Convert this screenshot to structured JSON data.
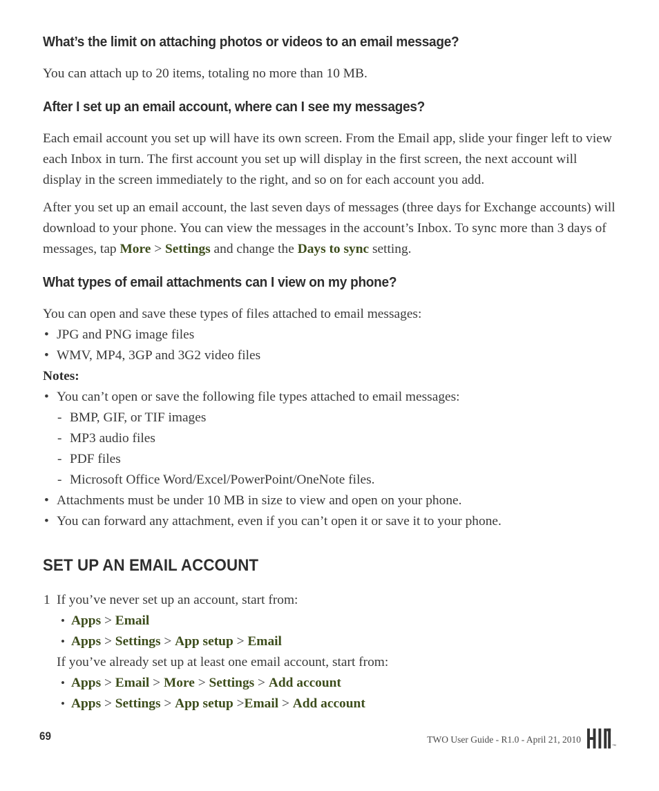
{
  "document": {
    "page_number": "69",
    "footer_text": "TWO User Guide - R1.0 - April 21, 2010",
    "logo_name": "KIN",
    "logo_trademark": "™",
    "accent_color": "#3d4d1c",
    "text_color": "#3a3a3a",
    "heading_color": "#2e2e2e"
  },
  "faq": {
    "q1": {
      "heading": "What’s the limit on attaching photos or videos to an email message?",
      "answer": "You can attach up to 20 items, totaling no more than 10 MB."
    },
    "q2": {
      "heading": "After I set up an email account, where can I see my messages?",
      "para1": "Each email account you set up will have its own screen. From the Email app, slide your finger left to view each Inbox in turn. The first account you set up will display in the first screen, the next account will display in the screen immediately to the right, and so on for each account you add.",
      "para2_a": "After you set up an email account, the last seven days of messages (three days for Exchange accounts) will download to your phone. You can view the messages in the account’s Inbox. To sync more than 3 days of messages, tap ",
      "para2_term1": "More",
      "para2_sep1": " > ",
      "para2_term2": "Settings",
      "para2_b": " and change the ",
      "para2_term3": "Days to sync",
      "para2_c": " setting."
    },
    "q3": {
      "heading": "What types of email attachments can I view on my phone?",
      "intro": "You can open and save these types of files attached to email messages:",
      "file_types": [
        "JPG and PNG image files",
        "WMV, MP4, 3GP and 3G2 video files"
      ],
      "notes_label": "Notes:",
      "note1": "You can’t open or save the following file types attached to email messages:",
      "unsupported": [
        "BMP, GIF, or TIF images",
        "MP3 audio files",
        "PDF files",
        "Microsoft Office Word/Excel/PowerPoint/OneNote files."
      ],
      "note2": "Attachments must be under 10 MB in size to view and open on your phone.",
      "note3": "You can forward any attachment, even if you can’t open it or save it to your phone."
    }
  },
  "setup_section": {
    "heading": "SET UP AN EMAIL ACCOUNT",
    "step_number": "1",
    "step_text": "If you’ve never set up an account, start from:",
    "path1": {
      "t1": "Apps",
      "s1": " > ",
      "t2": "Email"
    },
    "path2": {
      "t1": "Apps",
      "s1": " > ",
      "t2": "Settings",
      "s2": " > ",
      "t3": "App setup",
      "s3": " > ",
      "t4": "Email"
    },
    "alt_text": "If you’ve already set up at least one email account, start from:",
    "path3": {
      "t1": "Apps",
      "s1": " > ",
      "t2": "Email",
      "s2": " > ",
      "t3": "More",
      "s3": " > ",
      "t4": "Settings",
      "s4": " > ",
      "t5": "Add account"
    },
    "path4": {
      "t1": "Apps",
      "s1": " > ",
      "t2": "Settings",
      "s2": " > ",
      "t3": "App setup",
      "s3": " >",
      "t4": "Email",
      "s4": " > ",
      "t5": "Add account"
    }
  },
  "glyphs": {
    "bullet": "•",
    "dash": "-"
  }
}
